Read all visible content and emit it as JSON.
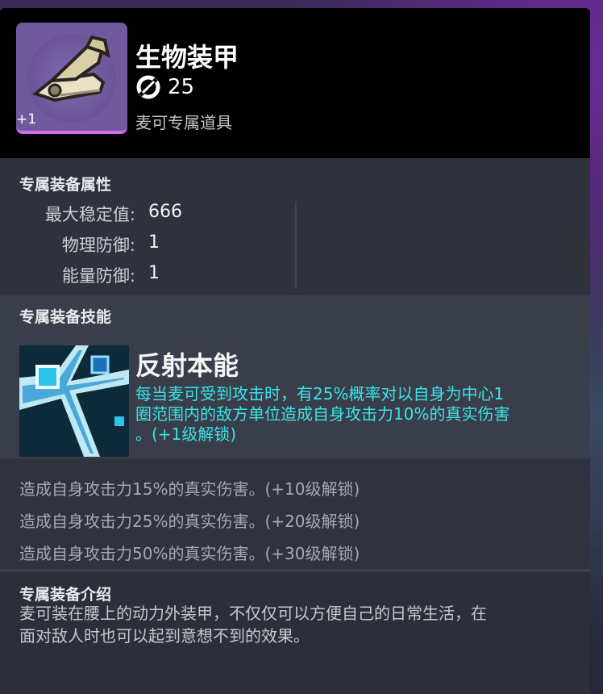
{
  "item": {
    "name": "生物装甲",
    "cost": "25",
    "subtitle": "麦可专属道具",
    "level_badge": "+1",
    "icon": "mechanical-arm-icon",
    "cost_icon": "energy-ring-icon"
  },
  "attributes": {
    "title": "专属装备属性",
    "rows": [
      {
        "label": "最大稳定值:",
        "value": "666"
      },
      {
        "label": "物理防御:",
        "value": "1"
      },
      {
        "label": "能量防御:",
        "value": "1"
      }
    ]
  },
  "skill": {
    "section_title": "专属装备技能",
    "name": "反射本能",
    "icon": "reflex-instinct-skill-icon",
    "description_lines": [
      "每当麦可受到攻击时，有25%概率对以自身为中心1",
      "圈范围内的敌方单位造成自身攻击力10%的真实伤害",
      "。(+1级解锁)"
    ],
    "upgrades": [
      "造成自身攻击力15%的真实伤害。(+10级解锁)",
      "造成自身攻击力25%的真实伤害。(+20级解锁)",
      "造成自身攻击力50%的真实伤害。(+30级解锁)"
    ]
  },
  "intro": {
    "title": "专属装备介绍",
    "lines": [
      "麦可装在腰上的动力外装甲，不仅仅可以方便自己的日常生活，在",
      "面对敌人时也可以起到意想不到的效果。"
    ]
  },
  "colors": {
    "skill_text": "#39e5e8",
    "icon_frame": "#6f5a9e",
    "icon_underline": "#d86cf0"
  }
}
